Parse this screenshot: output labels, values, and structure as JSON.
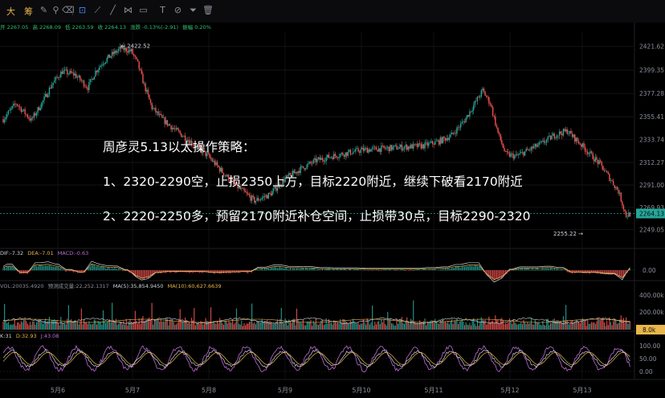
{
  "toolbar": {
    "brand_1": "大",
    "brand_2": "筹"
  },
  "ohlc": {
    "open": "开 2267.05",
    "high": "高 2268.09",
    "low": "低 2263.59",
    "close": "收 2264.13",
    "change": "涨跌 -0.13%(-2.91)",
    "amplitude": "振幅 0.20%"
  },
  "overlay": {
    "line1": "周彦灵5.13以太操作策略：",
    "line2": "1、2320-2290空，止损2350上方，目标2220附近，继续下破看2170附近",
    "line3": "2、2220-2250多，预留2170附近补仓空间，止损带30点，目标2290-2320"
  },
  "macd_legend": {
    "dif": "DIF:-7.32",
    "dea": "DEA:-7.01",
    "macd": "MACD:-0.63"
  },
  "volume_legend": {
    "vol": "VOL:20035.4920",
    "forecast": "预测成交量:22,252.1317",
    "ma5": "MA(5):35,854.9450",
    "ma10": "MA(10):60,627.6639"
  },
  "kdj_legend": {
    "k": "K:31",
    "d": "D:32.93",
    "j": "J:43.08"
  },
  "colors": {
    "up": "#26a69a",
    "down": "#ef5350",
    "background": "#000000",
    "price_tag": "#26a69a",
    "vol_tag": "#e8b64a"
  },
  "chart_data": [
    {
      "type": "candlestick",
      "ylim": [
        2238,
        2432
      ],
      "yticks": [
        "2421.62",
        "2399.35",
        "2377.28",
        "2355.41",
        "2333.74",
        "2312.27",
        "2291.00",
        "2269.93",
        "2249.05"
      ],
      "xticks": [
        "5月6",
        "5月7",
        "5月8",
        "5月9",
        "5月10",
        "5月11",
        "5月12",
        "5月13"
      ],
      "last_price": "2264.13",
      "annotations": [
        {
          "label": "← 2422.52",
          "value": 2422.52
        },
        {
          "label": "2255.22 →",
          "value": 2255.22
        }
      ],
      "trend_keypoints": [
        [
          0,
          2353
        ],
        [
          10,
          2368
        ],
        [
          22,
          2352
        ],
        [
          32,
          2372
        ],
        [
          38,
          2386
        ],
        [
          46,
          2398
        ],
        [
          56,
          2395
        ],
        [
          66,
          2383
        ],
        [
          72,
          2398
        ],
        [
          78,
          2407
        ],
        [
          84,
          2413
        ],
        [
          92,
          2420
        ],
        [
          100,
          2417
        ],
        [
          105,
          2405
        ],
        [
          110,
          2385
        ],
        [
          116,
          2364
        ],
        [
          124,
          2353
        ],
        [
          134,
          2343
        ],
        [
          146,
          2332
        ],
        [
          160,
          2318
        ],
        [
          172,
          2302
        ],
        [
          184,
          2288
        ],
        [
          196,
          2276
        ],
        [
          208,
          2282
        ],
        [
          220,
          2297
        ],
        [
          232,
          2306
        ],
        [
          244,
          2314
        ],
        [
          256,
          2318
        ],
        [
          268,
          2321
        ],
        [
          280,
          2324
        ],
        [
          292,
          2325
        ],
        [
          304,
          2326
        ],
        [
          316,
          2327
        ],
        [
          328,
          2328
        ],
        [
          340,
          2332
        ],
        [
          350,
          2338
        ],
        [
          360,
          2352
        ],
        [
          368,
          2368
        ],
        [
          374,
          2380
        ],
        [
          380,
          2368
        ],
        [
          386,
          2340
        ],
        [
          392,
          2320
        ],
        [
          400,
          2318
        ],
        [
          410,
          2324
        ],
        [
          420,
          2330
        ],
        [
          430,
          2338
        ],
        [
          440,
          2342
        ],
        [
          450,
          2330
        ],
        [
          458,
          2320
        ],
        [
          466,
          2310
        ],
        [
          474,
          2296
        ],
        [
          480,
          2285
        ],
        [
          486,
          2262
        ],
        [
          489,
          2264
        ]
      ]
    },
    {
      "type": "bar",
      "name": "MACD",
      "yticks": [
        "0.00"
      ]
    },
    {
      "type": "bar",
      "name": "VOL",
      "yticks": [
        "400.00k",
        "200.00k"
      ],
      "last_value": "8.0k"
    },
    {
      "type": "line",
      "name": "KDJ",
      "yticks": [
        "100.00",
        "50.00",
        "0.00"
      ]
    }
  ]
}
